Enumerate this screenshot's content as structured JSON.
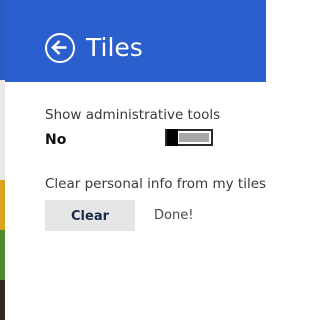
{
  "header": {
    "title": "Tiles",
    "background": "#2b5fce",
    "back_icon": "arrow-left-circle-icon"
  },
  "settings": {
    "admin_tools": {
      "label": "Show administrative tools",
      "state_text": "No",
      "enabled": false
    },
    "clear_personal_info": {
      "label": "Clear personal info from my tiles",
      "button_label": "Clear",
      "status_text": "Done!"
    }
  }
}
